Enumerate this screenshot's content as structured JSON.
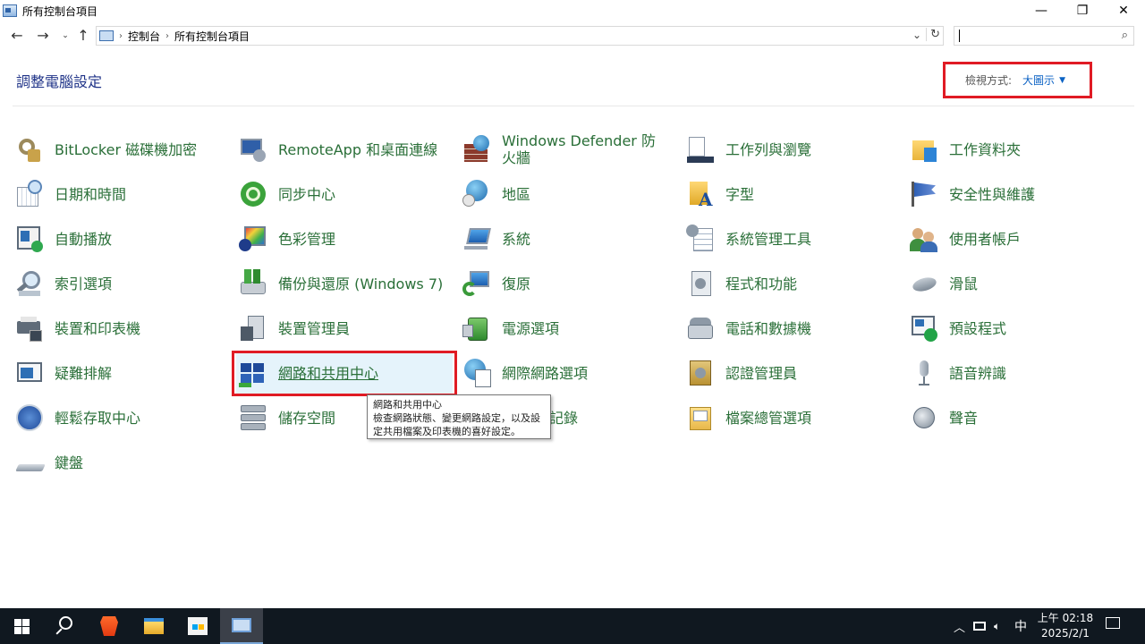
{
  "window": {
    "title": "所有控制台項目",
    "minimize": "—",
    "maximize": "❐",
    "close": "✕"
  },
  "nav": {
    "back": "←",
    "forward": "→",
    "dropdown": "⌄",
    "up": "↑"
  },
  "address": {
    "crumbs": [
      "控制台",
      "所有控制台項目"
    ],
    "separator": "›",
    "dropdown": "⌄",
    "refresh": "↻"
  },
  "search": {
    "placeholder": "",
    "icon": "search-icon"
  },
  "page_title": "調整電腦設定",
  "view_by": {
    "label": "檢視方式:",
    "value": "大圖示",
    "arrow": "▼"
  },
  "items": [
    {
      "label": "BitLocker 磁碟機加密",
      "icon": "bitlocker-icon"
    },
    {
      "label": "RemoteApp 和桌面連線",
      "icon": "remoteapp-icon"
    },
    {
      "label": "Windows Defender 防火牆",
      "icon": "firewall-icon"
    },
    {
      "label": "工作列與瀏覽",
      "icon": "taskbar-icon"
    },
    {
      "label": "工作資料夾",
      "icon": "work-folders-icon"
    },
    {
      "label": "日期和時間",
      "icon": "date-time-icon"
    },
    {
      "label": "同步中心",
      "icon": "sync-center-icon"
    },
    {
      "label": "地區",
      "icon": "region-icon"
    },
    {
      "label": "字型",
      "icon": "fonts-icon"
    },
    {
      "label": "安全性與維護",
      "icon": "security-maintenance-icon"
    },
    {
      "label": "自動播放",
      "icon": "autoplay-icon"
    },
    {
      "label": "色彩管理",
      "icon": "color-management-icon"
    },
    {
      "label": "系統",
      "icon": "system-icon"
    },
    {
      "label": "系統管理工具",
      "icon": "admin-tools-icon"
    },
    {
      "label": "使用者帳戶",
      "icon": "user-accounts-icon"
    },
    {
      "label": "索引選項",
      "icon": "indexing-options-icon"
    },
    {
      "label": "備份與還原 (Windows 7)",
      "icon": "backup-restore-icon"
    },
    {
      "label": "復原",
      "icon": "recovery-icon"
    },
    {
      "label": "程式和功能",
      "icon": "programs-features-icon"
    },
    {
      "label": "滑鼠",
      "icon": "mouse-icon"
    },
    {
      "label": "裝置和印表機",
      "icon": "devices-printers-icon"
    },
    {
      "label": "裝置管理員",
      "icon": "device-manager-icon"
    },
    {
      "label": "電源選項",
      "icon": "power-options-icon"
    },
    {
      "label": "電話和數據機",
      "icon": "phone-modem-icon"
    },
    {
      "label": "預設程式",
      "icon": "default-programs-icon"
    },
    {
      "label": "疑難排解",
      "icon": "troubleshooting-icon"
    },
    {
      "label": "網路和共用中心",
      "icon": "network-sharing-icon"
    },
    {
      "label": "網際網路選項",
      "icon": "internet-options-icon"
    },
    {
      "label": "認證管理員",
      "icon": "credential-manager-icon"
    },
    {
      "label": "語音辨識",
      "icon": "speech-recognition-icon"
    },
    {
      "label": "輕鬆存取中心",
      "icon": "ease-of-access-icon"
    },
    {
      "label": "儲存空間",
      "icon": "storage-spaces-icon"
    },
    {
      "label": "記錄",
      "icon": "file-history-icon"
    },
    {
      "label": "檔案總管選項",
      "icon": "file-explorer-options-icon"
    },
    {
      "label": "聲音",
      "icon": "sound-icon"
    },
    {
      "label": "鍵盤",
      "icon": "keyboard-icon"
    }
  ],
  "tooltip": {
    "title": "網路和共用中心",
    "body": "檢查網路狀態、變更網路設定，以及設定共用檔案及印表機的喜好設定。"
  },
  "taskbar": {
    "apps": [
      "windows-start-icon",
      "search-icon",
      "brave-browser-icon",
      "file-explorer-icon",
      "microsoft-store-icon",
      "control-panel-icon"
    ],
    "tray_up": "︿",
    "ime": "中",
    "time": "上午 02:18",
    "date": "2025/2/1"
  },
  "colors": {
    "link_green": "#2a6f38",
    "title_blue": "#1e3287",
    "accent_blue": "#0b62c4",
    "annotation_red": "#e01b24",
    "taskbar_bg": "#101820"
  }
}
